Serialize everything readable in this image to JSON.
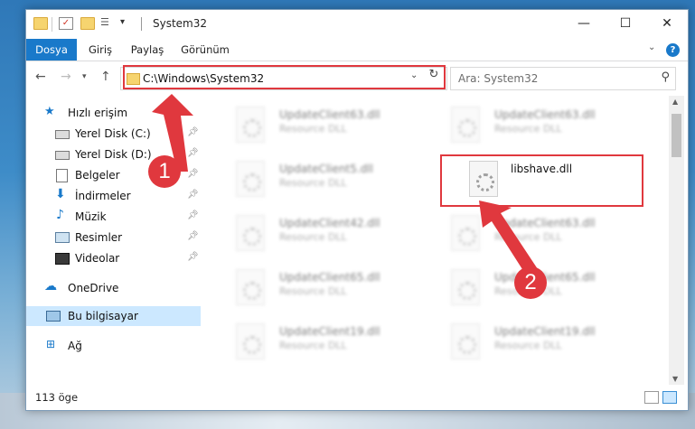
{
  "window": {
    "title": "System32"
  },
  "ribbon": {
    "tabs": [
      "Dosya",
      "Giriş",
      "Paylaş",
      "Görünüm"
    ]
  },
  "nav": {
    "address": "C:\\Windows\\System32",
    "search_placeholder": "Ara: System32"
  },
  "sidebar": {
    "items": [
      {
        "label": "Hızlı erişim",
        "icon": "star-icon"
      },
      {
        "label": "Yerel Disk (C:)",
        "icon": "drive-icon",
        "pinned": true
      },
      {
        "label": "Yerel Disk (D:)",
        "icon": "drive-icon",
        "pinned": true
      },
      {
        "label": "Belgeler",
        "icon": "document-icon",
        "pinned": true
      },
      {
        "label": "İndirmeler",
        "icon": "download-icon",
        "pinned": true
      },
      {
        "label": "Müzik",
        "icon": "music-icon",
        "pinned": true
      },
      {
        "label": "Resimler",
        "icon": "picture-icon",
        "pinned": true
      },
      {
        "label": "Videolar",
        "icon": "video-icon",
        "pinned": true
      },
      {
        "label": "OneDrive",
        "icon": "cloud-icon"
      },
      {
        "label": "Bu bilgisayar",
        "icon": "computer-icon",
        "selected": true
      },
      {
        "label": "Ağ",
        "icon": "network-icon"
      }
    ]
  },
  "files": {
    "left": [
      {
        "name": "UpdateClient63.dll",
        "type": "Resource DLL"
      },
      {
        "name": "UpdateClient5.dll",
        "type": "Resource DLL"
      },
      {
        "name": "UpdateClient42.dll",
        "type": "Resource DLL"
      },
      {
        "name": "UpdateClient65.dll",
        "type": "Resource DLL"
      },
      {
        "name": "UpdateClient19.dll",
        "type": "Resource DLL"
      }
    ],
    "right": [
      {
        "name": "UpdateClient63.dll",
        "type": "Resource DLL"
      },
      {
        "name": "libshave.dll",
        "type": ""
      },
      {
        "name": "UpdateClient63.dll",
        "type": "Resource DLL"
      },
      {
        "name": "UpdateClient65.dll",
        "type": "Resource DLL"
      },
      {
        "name": "UpdateClient19.dll",
        "type": "Resource DLL"
      }
    ]
  },
  "status": {
    "count": "113 öge"
  },
  "callouts": {
    "one": "1",
    "two": "2"
  },
  "colors": {
    "accent": "#1979ca",
    "highlight": "#e0383e",
    "selected": "#cce8ff"
  }
}
